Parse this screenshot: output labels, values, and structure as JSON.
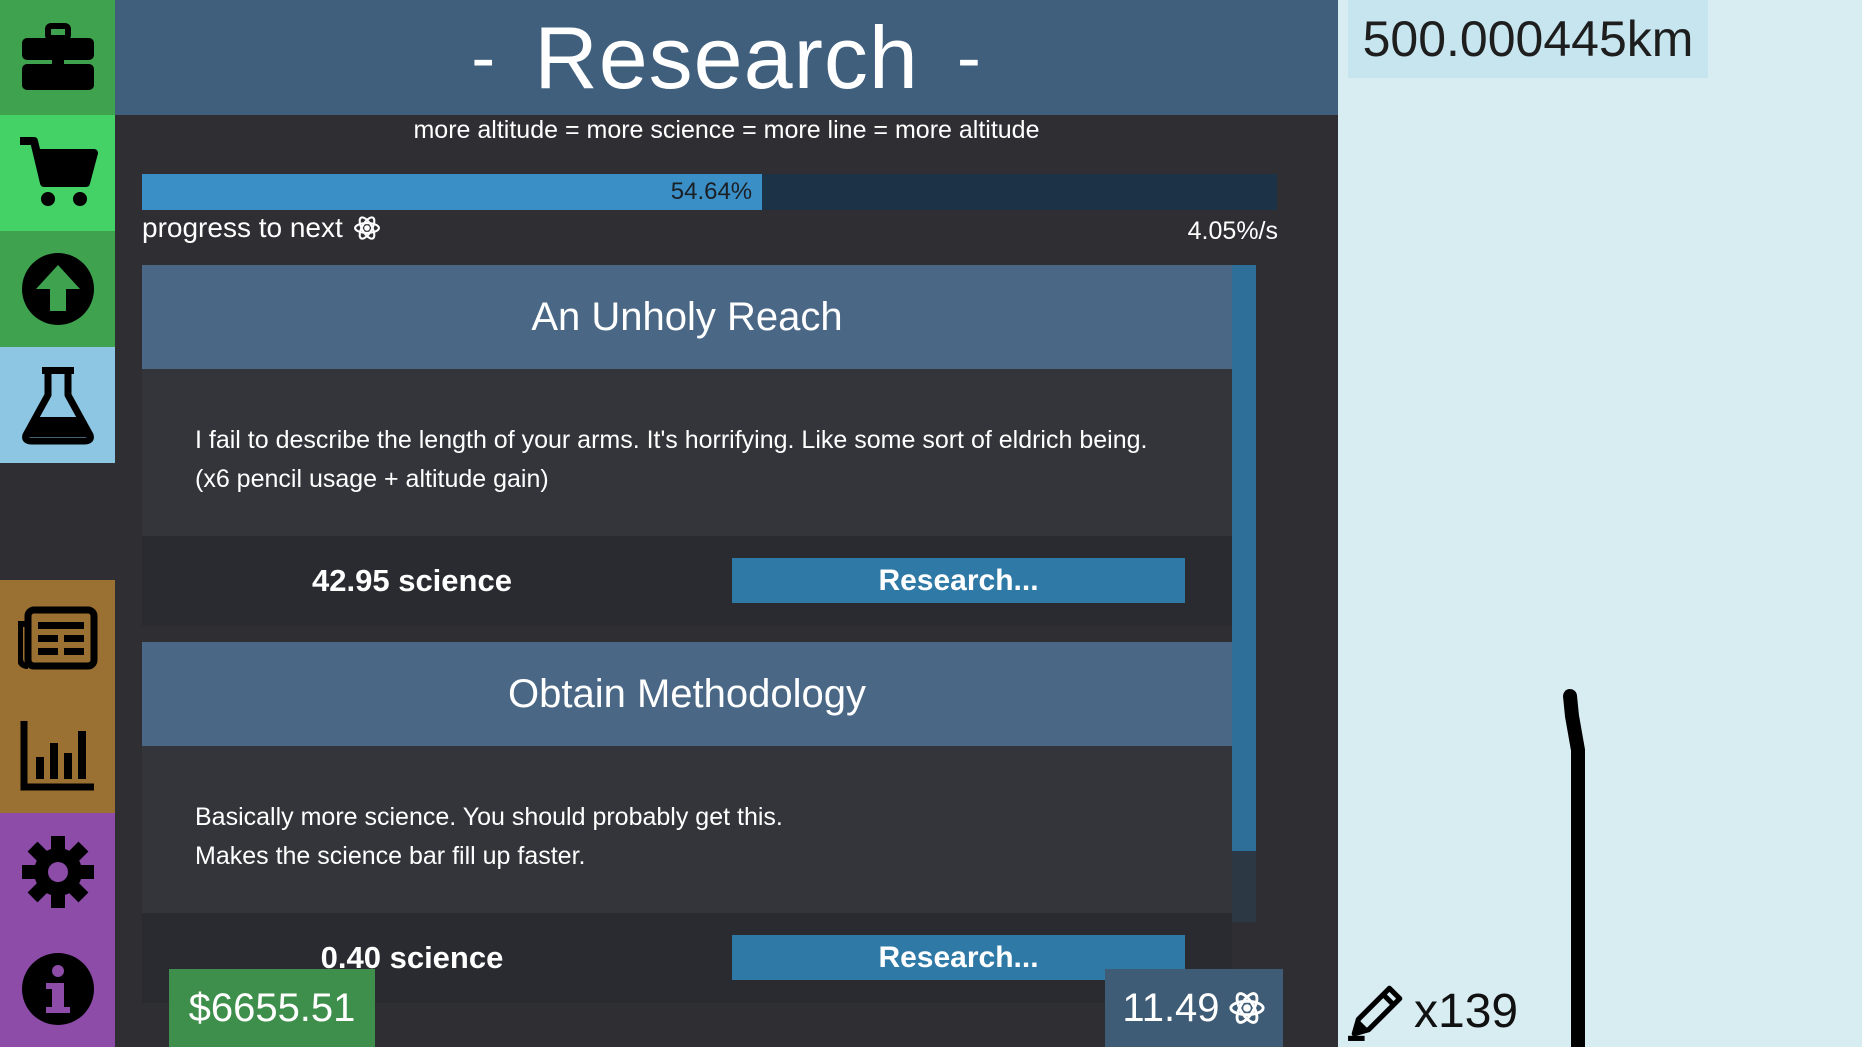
{
  "sidebar": {
    "items": [
      {
        "name": "toolbox",
        "icon": "briefcase-icon",
        "color": "#3fa24f"
      },
      {
        "name": "shop",
        "icon": "cart-icon",
        "color": "#44d166"
      },
      {
        "name": "upgrades",
        "icon": "up-arrow-circle-icon",
        "color": "#3fa24f"
      },
      {
        "name": "research",
        "icon": "flask-icon",
        "color": "#8cc6e2"
      },
      {
        "name": "news",
        "icon": "newspaper-icon",
        "color": "#9a7033"
      },
      {
        "name": "stats",
        "icon": "bar-chart-icon",
        "color": "#9a7033"
      },
      {
        "name": "settings",
        "icon": "gear-icon",
        "color": "#8c4ca8"
      },
      {
        "name": "info",
        "icon": "info-icon",
        "color": "#8c4ca8"
      }
    ]
  },
  "header": {
    "dash_left": "-",
    "title": "Research",
    "dash_right": "-",
    "tagline": "more altitude = more science = more line = more altitude"
  },
  "progress": {
    "fraction": 0.5464,
    "percent_label": "54.64%",
    "label": "progress to next",
    "rate": "4.05%/s"
  },
  "research_items": [
    {
      "title": "An Unholy Reach",
      "description_line1": "I fail to describe the length of your arms. It's horrifying. Like some sort of eldrich being.",
      "description_line2": "(x6 pencil usage + altitude gain)",
      "cost": "42.95 science",
      "button": "Research..."
    },
    {
      "title": "Obtain Methodology",
      "description_line1": "Basically more science. You should probably get this.",
      "description_line2": "Makes the science bar fill up faster.",
      "cost": "0.40 science",
      "button": "Research..."
    }
  ],
  "status": {
    "money": "$6655.51",
    "science": "11.49"
  },
  "game": {
    "altitude": "500.000445km",
    "pencil_count": "x139"
  },
  "colors": {
    "header": "#3f5f7d",
    "panel": "#2f2f33",
    "progress_fill": "#3b8fc7",
    "button": "#2f79a6",
    "sky": "#d8edf2"
  }
}
